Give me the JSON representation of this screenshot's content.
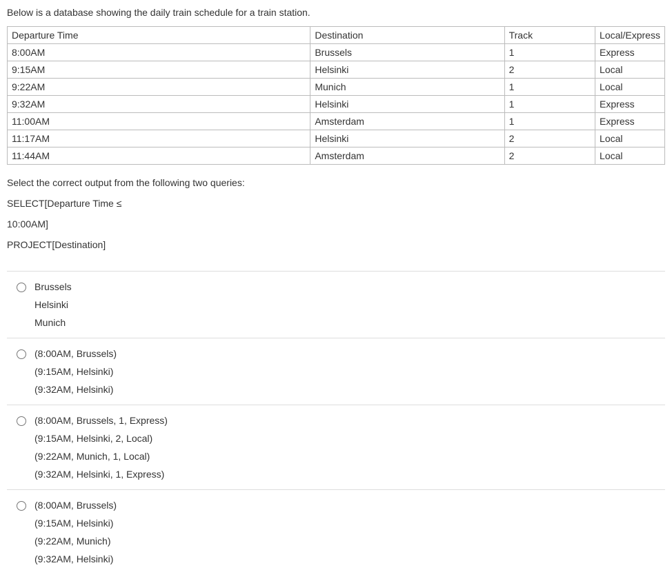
{
  "intro": "Below is a database showing the daily train schedule for a train station.",
  "table": {
    "headers": [
      "Departure Time",
      "Destination",
      "Track",
      "Local/Express"
    ],
    "rows": [
      [
        "8:00AM",
        "Brussels",
        "1",
        "Express"
      ],
      [
        "9:15AM",
        "Helsinki",
        "2",
        "Local"
      ],
      [
        "9:22AM",
        "Munich",
        "1",
        "Local"
      ],
      [
        "9:32AM",
        "Helsinki",
        "1",
        "Express"
      ],
      [
        "11:00AM",
        "Amsterdam",
        "1",
        "Express"
      ],
      [
        "11:17AM",
        "Helsinki",
        "2",
        "Local"
      ],
      [
        "11:44AM",
        "Amsterdam",
        "2",
        "Local"
      ]
    ]
  },
  "question": "Select the correct output from the following two queries:",
  "query_lines": [
    "SELECT[Departure Time ≤",
    "10:00AM]",
    "PROJECT[Destination]"
  ],
  "options": [
    {
      "lines": [
        "Brussels",
        "Helsinki",
        "Munich"
      ]
    },
    {
      "lines": [
        "(8:00AM, Brussels)",
        "(9:15AM, Helsinki)",
        "(9:32AM, Helsinki)"
      ]
    },
    {
      "lines": [
        "(8:00AM, Brussels, 1, Express)",
        "(9:15AM, Helsinki, 2, Local)",
        "(9:22AM, Munich, 1, Local)",
        "(9:32AM, Helsinki, 1, Express)"
      ]
    },
    {
      "lines": [
        "(8:00AM, Brussels)",
        "(9:15AM, Helsinki)",
        "(9:22AM, Munich)",
        "(9:32AM, Helsinki)"
      ]
    }
  ]
}
